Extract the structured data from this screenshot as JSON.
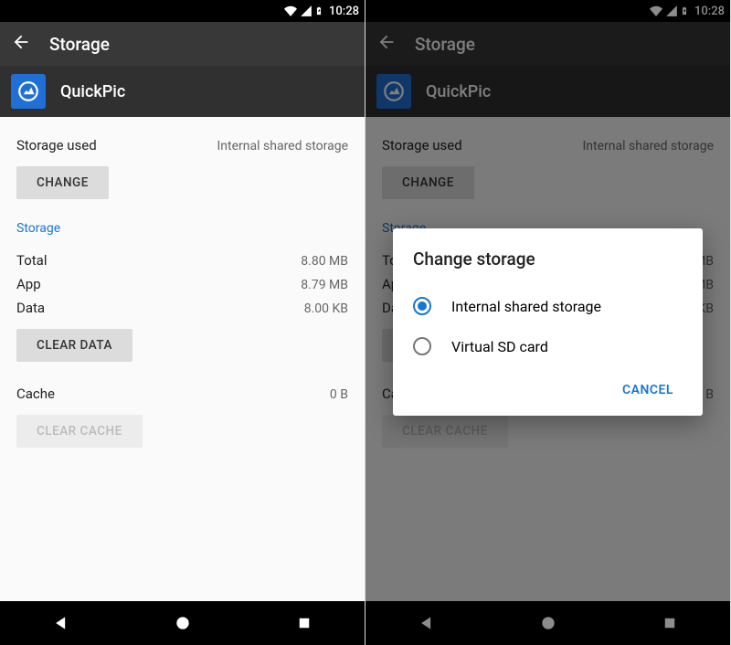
{
  "status": {
    "time": "10:28"
  },
  "toolbar": {
    "title": "Storage"
  },
  "app": {
    "name": "QuickPic"
  },
  "storage_used": {
    "label": "Storage used",
    "location": "Internal shared storage",
    "change_btn": "CHANGE"
  },
  "section_storage": {
    "head": "Storage"
  },
  "rows": {
    "total": {
      "label": "Total",
      "value": "8.80 MB"
    },
    "app": {
      "label": "App",
      "value": "8.79 MB"
    },
    "data": {
      "label": "Data",
      "value": "8.00 KB"
    }
  },
  "buttons": {
    "clear_data": "CLEAR DATA",
    "clear_cache": "CLEAR CACHE"
  },
  "cache": {
    "label": "Cache",
    "value": "0 B"
  },
  "dialog": {
    "title": "Change storage",
    "option_internal": "Internal shared storage",
    "option_sd": "Virtual SD card",
    "cancel": "CANCEL"
  }
}
